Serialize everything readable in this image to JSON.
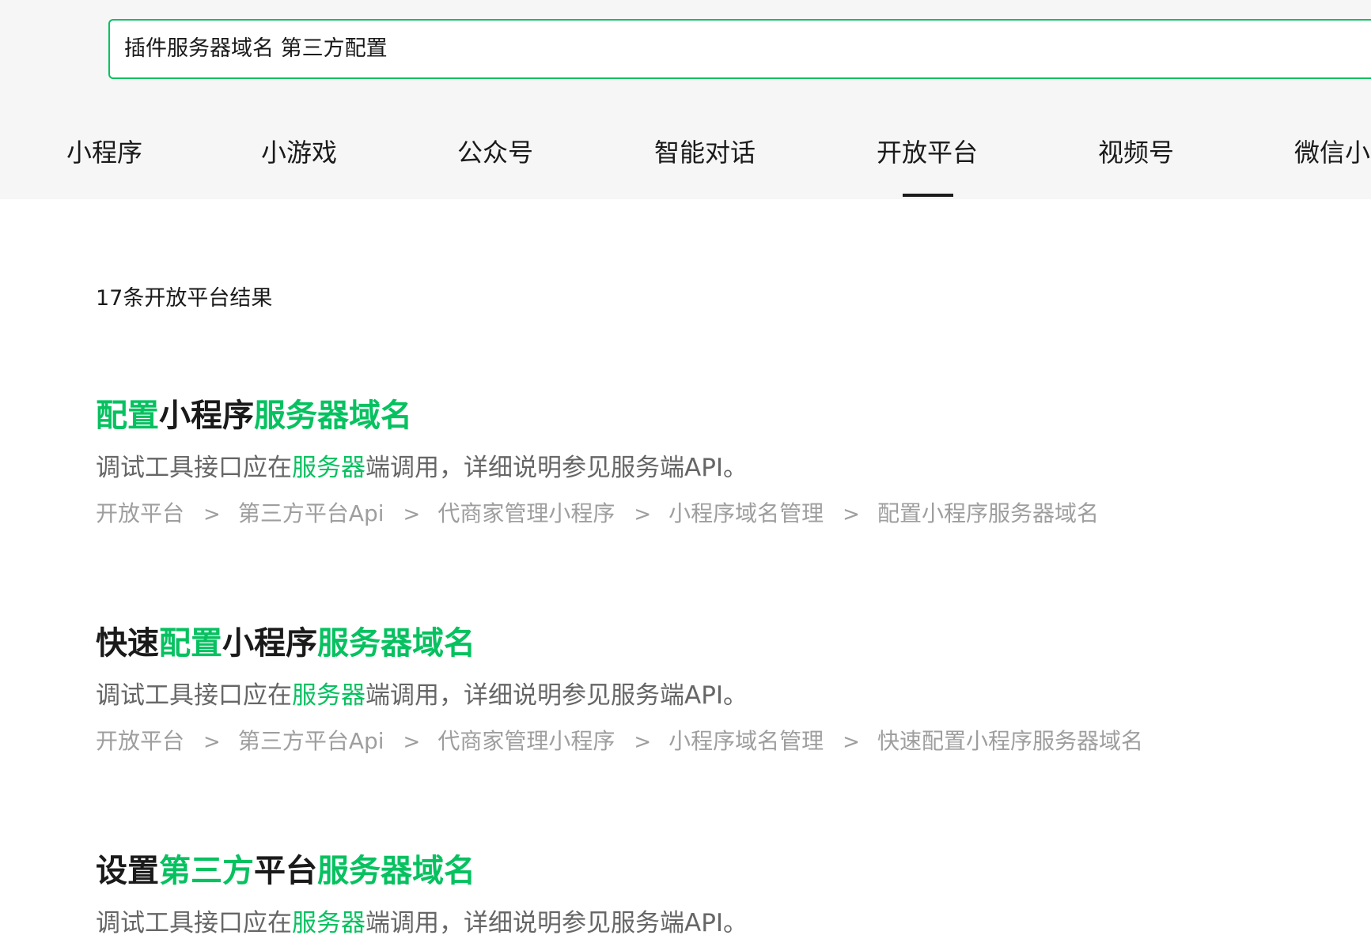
{
  "search": {
    "value": "插件服务器域名 第三方配置"
  },
  "tabs": [
    {
      "label": "小程序",
      "active": false
    },
    {
      "label": "小游戏",
      "active": false
    },
    {
      "label": "公众号",
      "active": false
    },
    {
      "label": "智能对话",
      "active": false
    },
    {
      "label": "开放平台",
      "active": true
    },
    {
      "label": "视频号",
      "active": false
    },
    {
      "label": "微信小",
      "active": false
    }
  ],
  "results_count": "17条开放平台结果",
  "results": [
    {
      "title_parts": [
        {
          "text": "配置",
          "highlight": true
        },
        {
          "text": "小程序",
          "highlight": false
        },
        {
          "text": "服务器域名",
          "highlight": true
        }
      ],
      "desc_parts": [
        {
          "text": "调试工具接口应在",
          "highlight": false
        },
        {
          "text": "服务器",
          "highlight": true
        },
        {
          "text": "端调用，详细说明参见服务端API。",
          "highlight": false
        }
      ],
      "breadcrumb": [
        "开放平台",
        "第三方平台Api",
        "代商家管理小程序",
        "小程序域名管理",
        "配置小程序服务器域名"
      ]
    },
    {
      "title_parts": [
        {
          "text": "快速",
          "highlight": false
        },
        {
          "text": "配置",
          "highlight": true
        },
        {
          "text": "小程序",
          "highlight": false
        },
        {
          "text": "服务器域名",
          "highlight": true
        }
      ],
      "desc_parts": [
        {
          "text": "调试工具接口应在",
          "highlight": false
        },
        {
          "text": "服务器",
          "highlight": true
        },
        {
          "text": "端调用，详细说明参见服务端API。",
          "highlight": false
        }
      ],
      "breadcrumb": [
        "开放平台",
        "第三方平台Api",
        "代商家管理小程序",
        "小程序域名管理",
        "快速配置小程序服务器域名"
      ]
    },
    {
      "title_parts": [
        {
          "text": "设置",
          "highlight": false
        },
        {
          "text": "第三方",
          "highlight": true
        },
        {
          "text": "平台",
          "highlight": false
        },
        {
          "text": "服务器域名",
          "highlight": true
        }
      ],
      "desc_parts": [
        {
          "text": "调试工具接口应在",
          "highlight": false
        },
        {
          "text": "服务器",
          "highlight": true
        },
        {
          "text": "端调用，详细说明参见服务端API。",
          "highlight": false
        }
      ],
      "breadcrumb": []
    }
  ],
  "colors": {
    "accent": "#07c160",
    "text": "#1a1a1a",
    "muted": "#9e9e9e",
    "desc": "#666666",
    "top_bg": "#f6f6f6"
  },
  "icons": {
    "breadcrumb_separator": "chevron-right-icon"
  }
}
